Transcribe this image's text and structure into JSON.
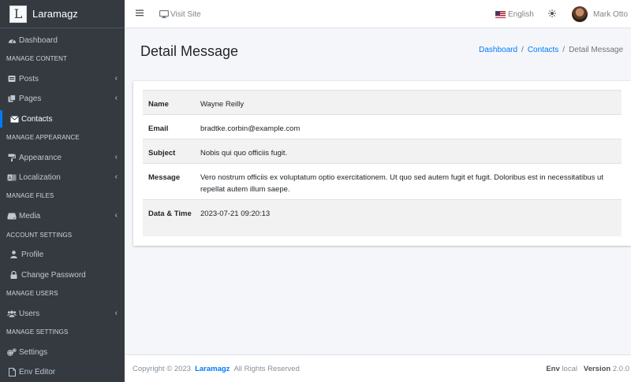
{
  "brand": {
    "logo_letter": "L",
    "name": "Laramagz"
  },
  "sidebar": {
    "dashboard": "Dashboard",
    "header_content": "MANAGE CONTENT",
    "posts": "Posts",
    "pages": "Pages",
    "contacts": "Contacts",
    "header_appearance": "MANAGE APPEARANCE",
    "appearance": "Appearance",
    "localization": "Localization",
    "header_files": "MANAGE FILES",
    "media": "Media",
    "header_account": "ACCOUNT SETTINGS",
    "profile": "Profile",
    "change_password": "Change Password",
    "header_users": "MANAGE USERS",
    "users": "Users",
    "header_settings": "MANAGE SETTINGS",
    "settings": "Settings",
    "env_editor": "Env Editor"
  },
  "topbar": {
    "visit_site": "Visit Site",
    "language": "English",
    "user_name": "Mark Otto"
  },
  "page": {
    "title": "Detail Message",
    "breadcrumb": {
      "home": "Dashboard",
      "parent": "Contacts",
      "current": "Detail Message"
    }
  },
  "detail": {
    "rows": [
      {
        "label": "Name",
        "value": "Wayne Reilly"
      },
      {
        "label": "Email",
        "value": "bradtke.corbin@example.com"
      },
      {
        "label": "Subject",
        "value": "Nobis qui quo officiis fugit."
      },
      {
        "label": "Message",
        "value": "Vero nostrum officiis ex voluptatum optio exercitationem. Ut quo sed autem fugit et fugit. Doloribus est in necessitatibus ut repellat autem illum saepe."
      },
      {
        "label": "Data & Time",
        "value": "2023-07-21 09:20:13"
      }
    ]
  },
  "footer": {
    "copyright": "Copyright © 2023",
    "brand": "Laramagz",
    "rights": "All Rights Reserved",
    "env_label": "Env",
    "env_value": "local",
    "version_label": "Version",
    "version_value": "2.0.0"
  },
  "colors": {
    "sidebar_bg": "#343a40",
    "accent": "#007bff",
    "page_bg": "#f4f6f9"
  }
}
